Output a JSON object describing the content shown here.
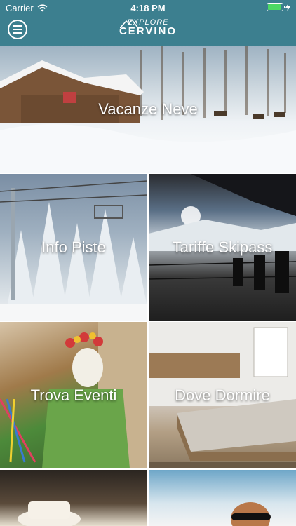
{
  "status_bar": {
    "carrier": "Carrier",
    "time": "4:18 PM"
  },
  "header": {
    "logo_top": "EXPLORE",
    "logo_bottom": "CERVINO"
  },
  "tiles": [
    {
      "label": "Vacanze Neve"
    },
    {
      "label": "Info Piste"
    },
    {
      "label": "Tariffe Skipass"
    },
    {
      "label": "Trova Eventi"
    },
    {
      "label": "Dove Dormire"
    },
    {
      "label": ""
    },
    {
      "label": ""
    }
  ],
  "colors": {
    "header": "#3c7f8f",
    "battery": "#4cd964"
  },
  "icons": [
    "wifi-icon",
    "battery-icon",
    "charging-icon",
    "menu-icon",
    "mountain-logo-icon"
  ]
}
